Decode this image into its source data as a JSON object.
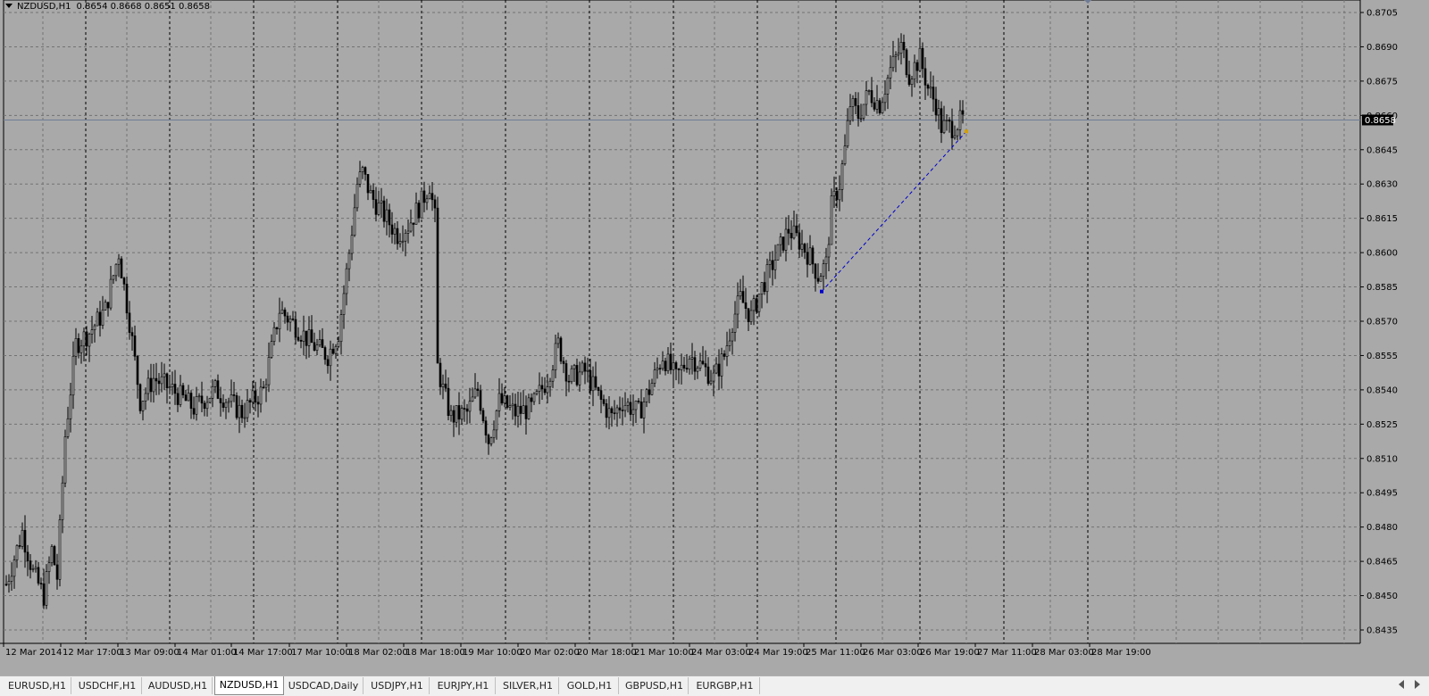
{
  "chart": {
    "header": {
      "symbol": "NZDUSD,H1",
      "ohlc": "0.8654 0.8668 0.8651 0.8658"
    },
    "current_price": "0.8658",
    "price_labels": [
      "0.8705",
      "0.8690",
      "0.8675",
      "0.8660",
      "0.8645",
      "0.8630",
      "0.8615",
      "0.8600",
      "0.8585",
      "0.8570",
      "0.8555",
      "0.8540",
      "0.8525",
      "0.8510",
      "0.8495",
      "0.8480",
      "0.8465",
      "0.8450",
      "0.8435"
    ],
    "time_labels": [
      "12 Mar 2014",
      "12 Mar 17:00",
      "13 Mar 09:00",
      "14 Mar 01:00",
      "14 Mar 17:00",
      "17 Mar 10:00",
      "18 Mar 02:00",
      "18 Mar 18:00",
      "19 Mar 10:00",
      "20 Mar 02:00",
      "20 Mar 18:00",
      "21 Mar 10:00",
      "24 Mar 03:00",
      "24 Mar 19:00",
      "25 Mar 11:00",
      "26 Mar 03:00",
      "26 Mar 19:00",
      "27 Mar 11:00",
      "28 Mar 03:00",
      "28 Mar 19:00"
    ],
    "colors": {
      "background": "#a9a9a9",
      "grid": "#727272",
      "candles": "#000000",
      "trendline": "#0000cc",
      "price_line": "#6f7d96"
    },
    "trendline": {
      "from_price": 0.8583,
      "to_price": 0.8653
    }
  },
  "chart_data": {
    "type": "candlestick",
    "symbol": "NZDUSD",
    "timeframe": "H1",
    "ylim": [
      0.843,
      0.871
    ],
    "grid": true,
    "close_path": [
      [
        0,
        0.8455
      ],
      [
        6,
        0.8478
      ],
      [
        10,
        0.846
      ],
      [
        14,
        0.845
      ],
      [
        17,
        0.847
      ],
      [
        19,
        0.8458
      ],
      [
        22,
        0.852
      ],
      [
        26,
        0.856
      ],
      [
        31,
        0.8565
      ],
      [
        37,
        0.8575
      ],
      [
        42,
        0.86
      ],
      [
        46,
        0.857
      ],
      [
        50,
        0.8535
      ],
      [
        55,
        0.8545
      ],
      [
        62,
        0.854
      ],
      [
        70,
        0.8532
      ],
      [
        78,
        0.854
      ],
      [
        88,
        0.853
      ],
      [
        96,
        0.854
      ],
      [
        102,
        0.8575
      ],
      [
        108,
        0.8568
      ],
      [
        114,
        0.856
      ],
      [
        120,
        0.8555
      ],
      [
        124,
        0.8565
      ],
      [
        128,
        0.86
      ],
      [
        131,
        0.863
      ],
      [
        133,
        0.8635
      ],
      [
        136,
        0.8625
      ],
      [
        140,
        0.8618
      ],
      [
        146,
        0.8608
      ],
      [
        150,
        0.8612
      ],
      [
        155,
        0.8622
      ],
      [
        158,
        0.863
      ],
      [
        160,
        0.8615
      ],
      [
        161,
        0.855
      ],
      [
        163,
        0.854
      ],
      [
        166,
        0.8528
      ],
      [
        172,
        0.853
      ],
      [
        176,
        0.854
      ],
      [
        180,
        0.8518
      ],
      [
        184,
        0.8535
      ],
      [
        190,
        0.853
      ],
      [
        196,
        0.8532
      ],
      [
        202,
        0.8545
      ],
      [
        206,
        0.856
      ],
      [
        210,
        0.8545
      ],
      [
        216,
        0.8548
      ],
      [
        222,
        0.8535
      ],
      [
        226,
        0.8528
      ],
      [
        230,
        0.8535
      ],
      [
        236,
        0.853
      ],
      [
        240,
        0.854
      ],
      [
        245,
        0.8555
      ],
      [
        250,
        0.8545
      ],
      [
        255,
        0.8555
      ],
      [
        260,
        0.855
      ],
      [
        264,
        0.8545
      ],
      [
        268,
        0.8555
      ],
      [
        271,
        0.857
      ],
      [
        274,
        0.858
      ],
      [
        278,
        0.8572
      ],
      [
        282,
        0.8585
      ],
      [
        288,
        0.86
      ],
      [
        292,
        0.861
      ],
      [
        296,
        0.8605
      ],
      [
        300,
        0.8598
      ],
      [
        303,
        0.859
      ],
      [
        306,
        0.8595
      ],
      [
        308,
        0.862
      ],
      [
        311,
        0.863
      ],
      [
        313,
        0.8645
      ],
      [
        315,
        0.8665
      ],
      [
        318,
        0.866
      ],
      [
        322,
        0.867
      ],
      [
        326,
        0.8665
      ],
      [
        330,
        0.868
      ],
      [
        334,
        0.869
      ],
      [
        337,
        0.8678
      ],
      [
        341,
        0.8685
      ],
      [
        344,
        0.8672
      ],
      [
        347,
        0.8665
      ],
      [
        349,
        0.8655
      ],
      [
        353,
        0.8655
      ],
      [
        357,
        0.8658
      ]
    ]
  },
  "tabs": [
    {
      "label": "EURUSD,H1",
      "active": false
    },
    {
      "label": "USDCHF,H1",
      "active": false
    },
    {
      "label": "AUDUSD,H1",
      "active": false
    },
    {
      "label": "NZDUSD,H1",
      "active": true
    },
    {
      "label": "USDCAD,Daily",
      "active": false
    },
    {
      "label": "USDJPY,H1",
      "active": false
    },
    {
      "label": "EURJPY,H1",
      "active": false
    },
    {
      "label": "SILVER,H1",
      "active": false
    },
    {
      "label": "GOLD,H1",
      "active": false
    },
    {
      "label": "GBPUSD,H1",
      "active": false
    },
    {
      "label": "EURGBP,H1",
      "active": false
    }
  ]
}
